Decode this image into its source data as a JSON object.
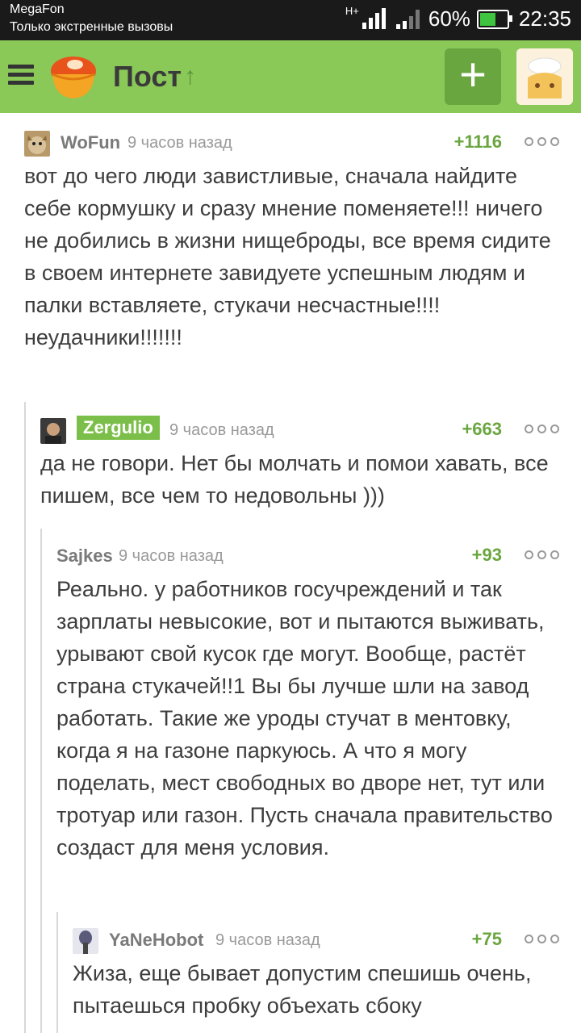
{
  "status_bar": {
    "carrier": "MegaFon",
    "emergency": "Только экстренные вызовы",
    "battery": "60%",
    "battery_level": 0.6,
    "time": "22:35",
    "network_label": "H+"
  },
  "app_bar": {
    "title": "Пост",
    "menu_icon": "hamburger-menu-icon",
    "logo_icon": "cupcake-logo-icon",
    "add_label": "+",
    "sort_icon": "arrow-up-icon"
  },
  "comments": [
    {
      "user": "WoFun",
      "time": "9 часов назад",
      "rating": "+1116",
      "text": "вот до чего люди завистливые, сначала найдите себе кормушку и сразу мнение поменяете!!! ничего не добились в жизни нищеброды, все время сидите в своем интернете завидуете успешным людям и палки вставляете, стукачи несчастные!!!! неудачники!!!!!!!"
    },
    {
      "user": "Zergulio",
      "time": "9 часов назад",
      "rating": "+663",
      "text": "да не говори. Нет бы молчать и помои хавать, все пишем, все чем то недовольны )))"
    },
    {
      "user": "Sajkes",
      "time": "9 часов назад",
      "rating": "+93",
      "text": "Реально. у работников госучреждений и так зарплаты невысокие, вот и пытаются выживать, урывают свой кусок где могут. Вообще, растёт страна стукачей!!1 Вы бы лучше шли на завод работать. Такие же уроды стучат в ментовку, когда я на газоне паркуюсь. А что я могу поделать, мест свободных во дворе нет, тут или тротуар или газон. Пусть сначала правительство создаст для меня условия."
    },
    {
      "user": "YaNeHobot",
      "time": "9 часов назад",
      "rating": "+75",
      "text": "Жиза, еще бывает допустим спешишь очень, пытаешься пробку объехать сбоку"
    }
  ],
  "colors": {
    "app_bar": "#8ac858",
    "accent": "#6aa63f",
    "text": "#3d3d3d",
    "muted": "#9a9a9a"
  }
}
